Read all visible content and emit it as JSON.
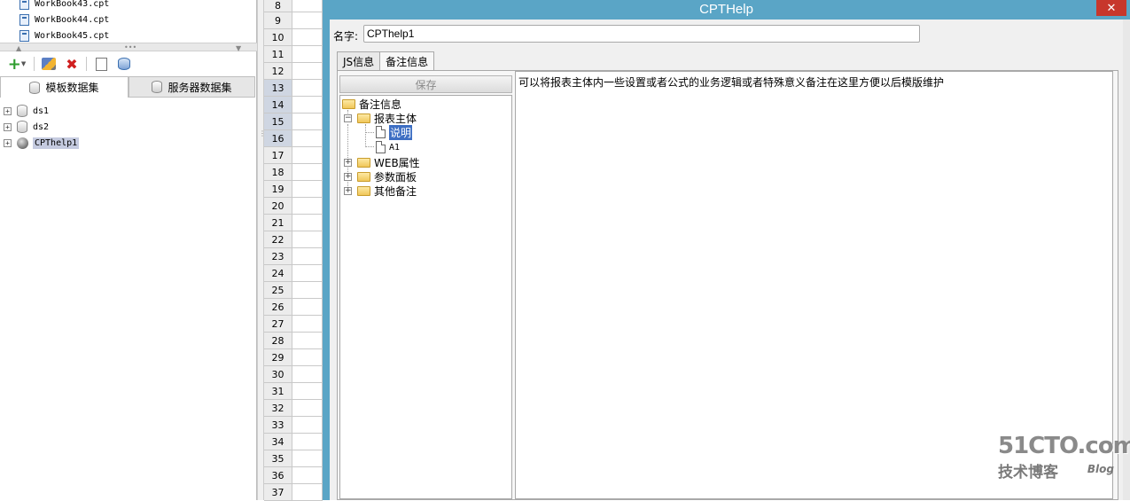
{
  "left_panel": {
    "files": [
      "WorkBook43.cpt",
      "WorkBook44.cpt",
      "WorkBook45.cpt"
    ],
    "splitter_dots": "•••",
    "tabs": [
      "模板数据集",
      "服务器数据集"
    ],
    "datasets": [
      {
        "name": "ds1",
        "icon": "database-icon"
      },
      {
        "name": "ds2",
        "icon": "database-icon"
      },
      {
        "name": "CPThelp1",
        "icon": "globe-icon",
        "selected": true
      }
    ]
  },
  "grid": {
    "row_numbers": [
      "8",
      "9",
      "10",
      "11",
      "12",
      "13",
      "14",
      "15",
      "16",
      "17",
      "18",
      "19",
      "20",
      "21",
      "22",
      "23",
      "24",
      "25",
      "26",
      "27",
      "28",
      "29",
      "30",
      "31",
      "32",
      "33",
      "34",
      "35",
      "36",
      "37"
    ],
    "highlighted_rows": [
      "13",
      "14",
      "15",
      "16"
    ]
  },
  "dialog": {
    "title": "CPTHelp",
    "close_label": "✕",
    "name_label": "名字:",
    "name_value": "CPThelp1",
    "tabs": [
      "JS信息",
      "备注信息"
    ],
    "active_tab": "备注信息",
    "save_label": "保存",
    "tree": {
      "root": "备注信息",
      "report_body": "报表主体",
      "child_selected": "说明",
      "child_a1": "A1",
      "web_attr": "WEB属性",
      "param_panel": "参数面板",
      "other_notes": "其他备注"
    },
    "note_text": "可以将报表主体内一些设置或者公式的业务逻辑或者特殊意义备注在这里方便以后模版维护"
  },
  "watermark": {
    "logo": "51CTO.com",
    "subtitle": "技术博客",
    "blog": "Blog"
  },
  "colors": {
    "dialog_frame": "#5aa5c6",
    "close_button": "#c7372c",
    "selection": "#3d6ec3"
  }
}
